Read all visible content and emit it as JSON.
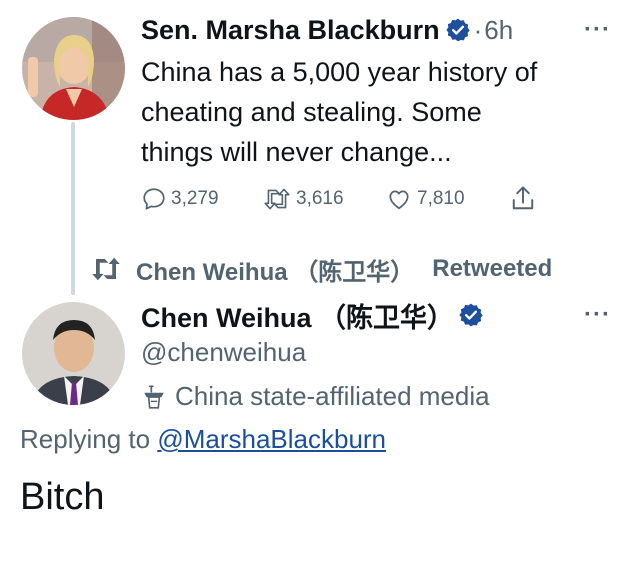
{
  "tweet1": {
    "author_name": "Sen. Marsha Blackburn",
    "time_sep": "·",
    "time": "6h",
    "more": "···",
    "text_lines": [
      "China has a 5,000 year history of",
      "cheating and stealing. Some",
      "things will never change..."
    ],
    "replies": "3,279",
    "retweets": "3,616",
    "likes": "7,810",
    "verified_color": "#1d9bf0"
  },
  "retweet_context": {
    "retweeter": "Chen Weihua （陈卫华）",
    "label": "Retweeted"
  },
  "tweet2": {
    "author_name": "Chen Weihua （陈卫华）",
    "handle": "@chenweihua",
    "affiliation": "China state-affiliated media",
    "more": "···",
    "replying_prefix": "Replying to",
    "replying_handle": "@MarshaBlackburn",
    "text": "Bitch"
  },
  "icons": {
    "reply": "reply-icon",
    "retweet": "retweet-icon",
    "like": "heart-icon",
    "share": "share-icon",
    "verified": "verified-badge-icon",
    "affiliation": "state-media-podium-icon"
  }
}
